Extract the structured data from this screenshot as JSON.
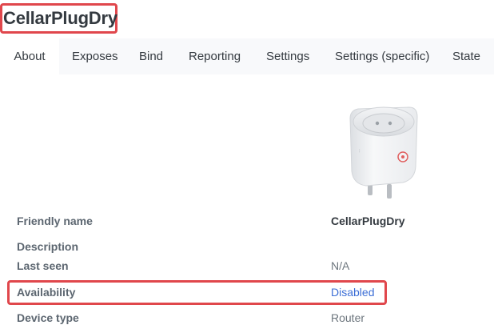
{
  "device": {
    "name": "CellarPlugDry"
  },
  "tabs": [
    {
      "label": "About",
      "active": true
    },
    {
      "label": "Exposes",
      "active": false
    },
    {
      "label": "Bind",
      "active": false
    },
    {
      "label": "Reporting",
      "active": false
    },
    {
      "label": "Settings",
      "active": false
    },
    {
      "label": "Settings (specific)",
      "active": false
    },
    {
      "label": "State",
      "active": false
    }
  ],
  "about": {
    "friendly_name": {
      "label": "Friendly name",
      "value": "CellarPlugDry"
    },
    "description": {
      "label": "Description",
      "value": ""
    },
    "last_seen": {
      "label": "Last seen",
      "value": "N/A"
    },
    "availability": {
      "label": "Availability",
      "value": "Disabled"
    },
    "device_type": {
      "label": "Device type",
      "value": "Router"
    }
  },
  "colors": {
    "highlight": "#e0474c",
    "link": "#3d6fd6",
    "tab_bar": "#f8f9fb"
  }
}
